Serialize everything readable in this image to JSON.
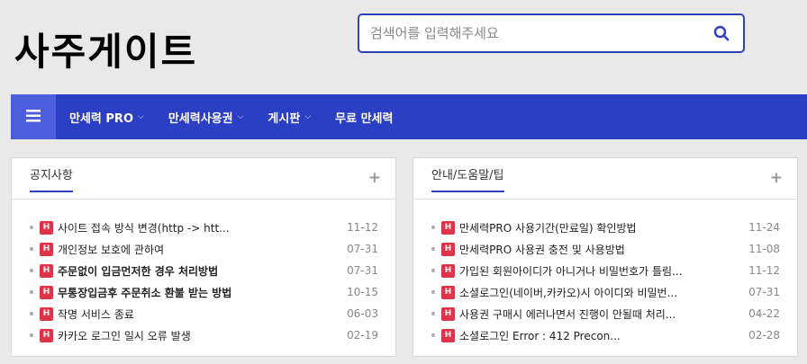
{
  "logo": {
    "text": "사주게이트"
  },
  "search": {
    "placeholder": "검색어를 입력해주세요",
    "value": ""
  },
  "nav": {
    "items": [
      {
        "label": "만세력 PRO",
        "caret": "⌵"
      },
      {
        "label": "만세력사용권",
        "caret": "⌵"
      },
      {
        "label": "게시판",
        "caret": "⌵"
      },
      {
        "label": "무료 만세력",
        "caret": ""
      }
    ]
  },
  "notice": {
    "title": "공지사항",
    "plus": "+",
    "badge": "H",
    "items": [
      {
        "title": "사이트 접속 방식 변경(http -> htt...",
        "date": "11-12",
        "bold": false
      },
      {
        "title": "개인정보 보호에 관하여",
        "date": "07-31",
        "bold": false
      },
      {
        "title": "주문없이 입금먼저한 경우 처리방법",
        "date": "07-31",
        "bold": true
      },
      {
        "title": "무통장입금후 주문취소 환불 받는 방법",
        "date": "10-15",
        "bold": true
      },
      {
        "title": "작명 서비스 종료",
        "date": "06-03",
        "bold": false
      },
      {
        "title": "카카오 로그인 일시 오류 발생",
        "date": "02-19",
        "bold": false
      }
    ]
  },
  "guide": {
    "title": "안내/도움말/팁",
    "plus": "+",
    "badge": "H",
    "items": [
      {
        "title": "만세력PRO 사용기간(만료일) 확인방법",
        "date": "11-24",
        "bold": false
      },
      {
        "title": "만세력PRO 사용권 충전 및 사용방법",
        "date": "11-08",
        "bold": false
      },
      {
        "title": "가입된 회원아이디가 아니거나 비밀번호가 틀림...",
        "date": "11-12",
        "bold": false
      },
      {
        "title": "소셜로그인(네이버,카카오)시 아이디와 비밀번...",
        "date": "07-31",
        "bold": false
      },
      {
        "title": "사용권 구매시 에러나면서 진행이 안될때 처리...",
        "date": "04-22",
        "bold": false
      },
      {
        "title": "소셜로그인 Error : 412 Precon...",
        "date": "02-28",
        "bold": false
      }
    ]
  }
}
